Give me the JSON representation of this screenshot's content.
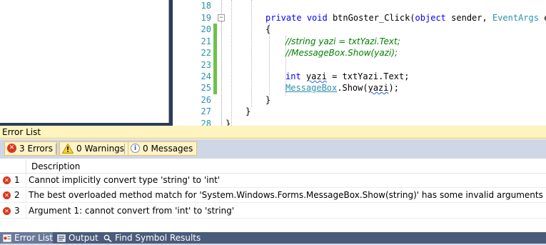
{
  "editor": {
    "line_numbers": [
      "18",
      "19",
      "20",
      "21",
      "22",
      "23",
      "24",
      "25",
      "26",
      "27",
      "28"
    ],
    "code": {
      "l19_kw1": "private",
      "l19_kw2": "void",
      "l19_name": "btnGoster_Click(",
      "l19_kw3": "object",
      "l19_sender": "sender,",
      "l19_type": "EventArgs",
      "l19_tail": "e)",
      "l20": "{",
      "l21": "//string yazi = txtYazi.Text;",
      "l22": "//MessageBox.Show(yazi);",
      "l24_kw": "int",
      "l24_rest1": "yazi",
      "l24_rest2": "= txtYazi.Text;",
      "l25_type": "MessageBox",
      "l25_dot": ".Show(",
      "l25_arg": "yazi",
      "l25_end": ");",
      "l26": "}",
      "l27": "}",
      "l28": "}"
    },
    "collapse_glyph": "−"
  },
  "error_list": {
    "title": "Error List",
    "filters": {
      "errors": "3 Errors",
      "warnings": "0 Warnings",
      "messages": "0 Messages"
    },
    "column_description": "Description",
    "rows": [
      {
        "num": "1",
        "description": "Cannot implicitly convert type 'string' to 'int'"
      },
      {
        "num": "2",
        "description": "The best overloaded method match for 'System.Windows.Forms.MessageBox.Show(string)' has some invalid arguments"
      },
      {
        "num": "3",
        "description": "Argument 1: cannot convert from 'int' to 'string'"
      }
    ],
    "error_glyph": "✕",
    "info_glyph": "i"
  },
  "bottom_tabs": {
    "error_list": "Error List",
    "output": "Output",
    "find_symbol": "Find Symbol Results"
  },
  "colors": {
    "line_number": "#2b91af",
    "keyword": "#0000ff",
    "type": "#2b91af",
    "comment": "#008000",
    "change_marker": "#6cc24a",
    "error_icon": "#d9381e",
    "filter_button_bg": "#fff3c8"
  }
}
